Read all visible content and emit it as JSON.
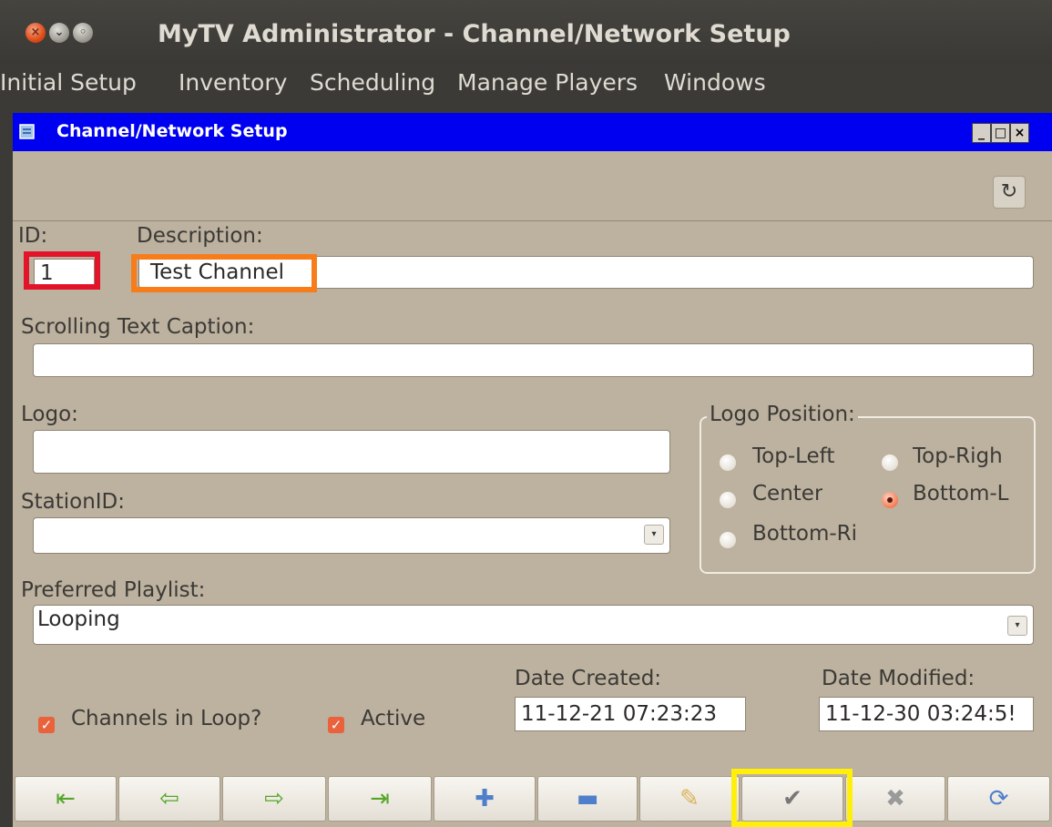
{
  "window": {
    "title": "MyTV Administrator - Channel/Network Setup"
  },
  "menu": [
    "Initial Setup",
    "Inventory",
    "Scheduling",
    "Manage Players",
    "Windows"
  ],
  "dialog": {
    "title": "Channel/Network Setup",
    "controls": {
      "minimize": "_",
      "maximize": "□",
      "close": "×"
    }
  },
  "form": {
    "id_label": "ID:",
    "id_value": "1",
    "description_label": "Description:",
    "description_value": "Test Channel",
    "caption_label": "Scrolling Text Caption:",
    "caption_value": "",
    "logo_label": "Logo:",
    "logo_value": "",
    "station_label": "StationID:",
    "station_value": "",
    "playlist_label": "Preferred Playlist:",
    "playlist_value": "Looping",
    "logo_position": {
      "label": "Logo Position:",
      "options": [
        "Top-Left",
        "Top-Righ",
        "Center",
        "Bottom-L",
        "Bottom-Ri"
      ],
      "selected": "Bottom-L"
    },
    "channels_in_loop_label": "Channels in Loop?",
    "channels_in_loop_checked": true,
    "active_label": "Active",
    "active_checked": true,
    "date_created_label": "Date Created:",
    "date_created_value": "11-12-21 07:23:23",
    "date_modified_label": "Date Modified:",
    "date_modified_value": "11-12-30 03:24:5!"
  },
  "nav_icons": [
    "first-record-icon",
    "previous-record-icon",
    "next-record-icon",
    "last-record-icon",
    "add-icon",
    "delete-icon",
    "edit-icon",
    "save-check-icon",
    "cancel-icon",
    "refresh-icon"
  ],
  "colors": {
    "dialog_title_bar": "#0000f0",
    "form_background": "#bdb19f",
    "highlight_id": "#e3132a",
    "highlight_description": "#f77d1b",
    "highlight_save": "#ffef0a",
    "check_accent": "#e9623b"
  }
}
